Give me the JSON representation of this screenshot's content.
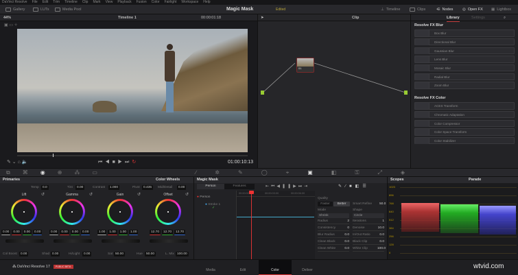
{
  "menu": [
    "DaVinci Resolve",
    "File",
    "Edit",
    "Trim",
    "Timeline",
    "Clip",
    "Mark",
    "View",
    "Playback",
    "Fusion",
    "Color",
    "Fairlight",
    "Workspace",
    "Help"
  ],
  "toolbar": {
    "gallery": "Gallery",
    "luts": "LUTs",
    "media_pool": "Media Pool",
    "title": "Magic Mask",
    "status": "Edited",
    "timeline": "Timeline",
    "clips": "Clips",
    "nodes": "Nodes",
    "open_fx": "Open FX",
    "lightbox": "Lightbox"
  },
  "viewer": {
    "zoom": "44%",
    "timeline": "Timeline 1",
    "timecode": "00:00:01:18",
    "playhead_timecode": "01:00:10:13"
  },
  "nodes": {
    "mode": "Clip",
    "node_label": "01"
  },
  "library": {
    "tabs": [
      "Library",
      "Settings"
    ],
    "sections": [
      {
        "title": "Resolve FX Blur",
        "items": [
          "Box Blur",
          "Directional Blur",
          "Gaussian Blur",
          "Lens Blur",
          "Mosaic Blur",
          "Radial Blur",
          "Zoom Blur"
        ]
      },
      {
        "title": "Resolve FX Color",
        "items": [
          "ACES Transform",
          "Chromatic Adaptation",
          "Color Compressor",
          "Color Space Transform",
          "Color Stabilizer"
        ]
      }
    ]
  },
  "primaries": {
    "title": "Primaries",
    "mode": "Color Wheels",
    "top": [
      {
        "label": "Temp",
        "value": "0.0"
      },
      {
        "label": "Tint",
        "value": "0.00"
      },
      {
        "label": "Contrast",
        "value": "1.000"
      },
      {
        "label": "Pivot",
        "value": "0.435"
      },
      {
        "label": "Mid/Detail",
        "value": "0.00"
      }
    ],
    "wheels": [
      {
        "name": "Lift",
        "values": [
          "0.00",
          "0.00",
          "0.00",
          "0.00"
        ]
      },
      {
        "name": "Gamma",
        "values": [
          "0.00",
          "0.00",
          "0.00",
          "0.00"
        ]
      },
      {
        "name": "Gain",
        "values": [
          "1.00",
          "1.00",
          "1.00",
          "1.00"
        ]
      },
      {
        "name": "Offset",
        "values": [
          "12.70",
          "12.70",
          "12.70"
        ]
      }
    ],
    "bottom": [
      {
        "label": "Col Boost",
        "value": "0.00"
      },
      {
        "label": "Shad",
        "value": "0.00"
      },
      {
        "label": "Hi/Light",
        "value": "0.00"
      },
      {
        "label": "Sat",
        "value": "50.00"
      },
      {
        "label": "Hue",
        "value": "50.00"
      },
      {
        "label": "L. Mix",
        "value": "100.00"
      }
    ]
  },
  "magic_mask": {
    "title": "Magic Mask",
    "tabs": [
      "Person",
      "Features"
    ],
    "ruler": [
      "00:00:00:00",
      "00:00:03:00",
      "00:00:06:00"
    ],
    "tracks": [
      "Person",
      "Stroke 1"
    ],
    "quality_label": "Quality",
    "quality": [
      "Faster",
      "Better"
    ],
    "smart_refine": {
      "label": "Smart Refine",
      "value": "50.0"
    },
    "mode_label": "Mode",
    "mode": "Shrink",
    "shape_label": "Shape",
    "shape": "Circle",
    "params": [
      {
        "label": "Radius",
        "value": "2"
      },
      {
        "label": "Iterations",
        "value": "1"
      },
      {
        "label": "Consistency",
        "value": "0"
      },
      {
        "label": "Denoise",
        "value": "10.0"
      },
      {
        "label": "Blur Radius",
        "value": "0.0"
      },
      {
        "label": "In/Out Ratio",
        "value": "0.0"
      },
      {
        "label": "Clean Black",
        "value": "0.0"
      },
      {
        "label": "Black Clip",
        "value": "0.0"
      },
      {
        "label": "Clean White",
        "value": "0.0"
      },
      {
        "label": "White Clip",
        "value": "100.0"
      }
    ]
  },
  "scopes": {
    "title": "Scopes",
    "mode": "Parade",
    "ticks": [
      "1023",
      "896",
      "768",
      "640",
      "512",
      "384",
      "256",
      "128",
      "0"
    ]
  },
  "bottom": {
    "app": "DaVinci Resolve 17",
    "badge": "PUBLIC BETA",
    "pages": [
      "Media",
      "Edit",
      "Color",
      "Deliver"
    ],
    "active": "Color",
    "watermark": "wtvid.com"
  }
}
